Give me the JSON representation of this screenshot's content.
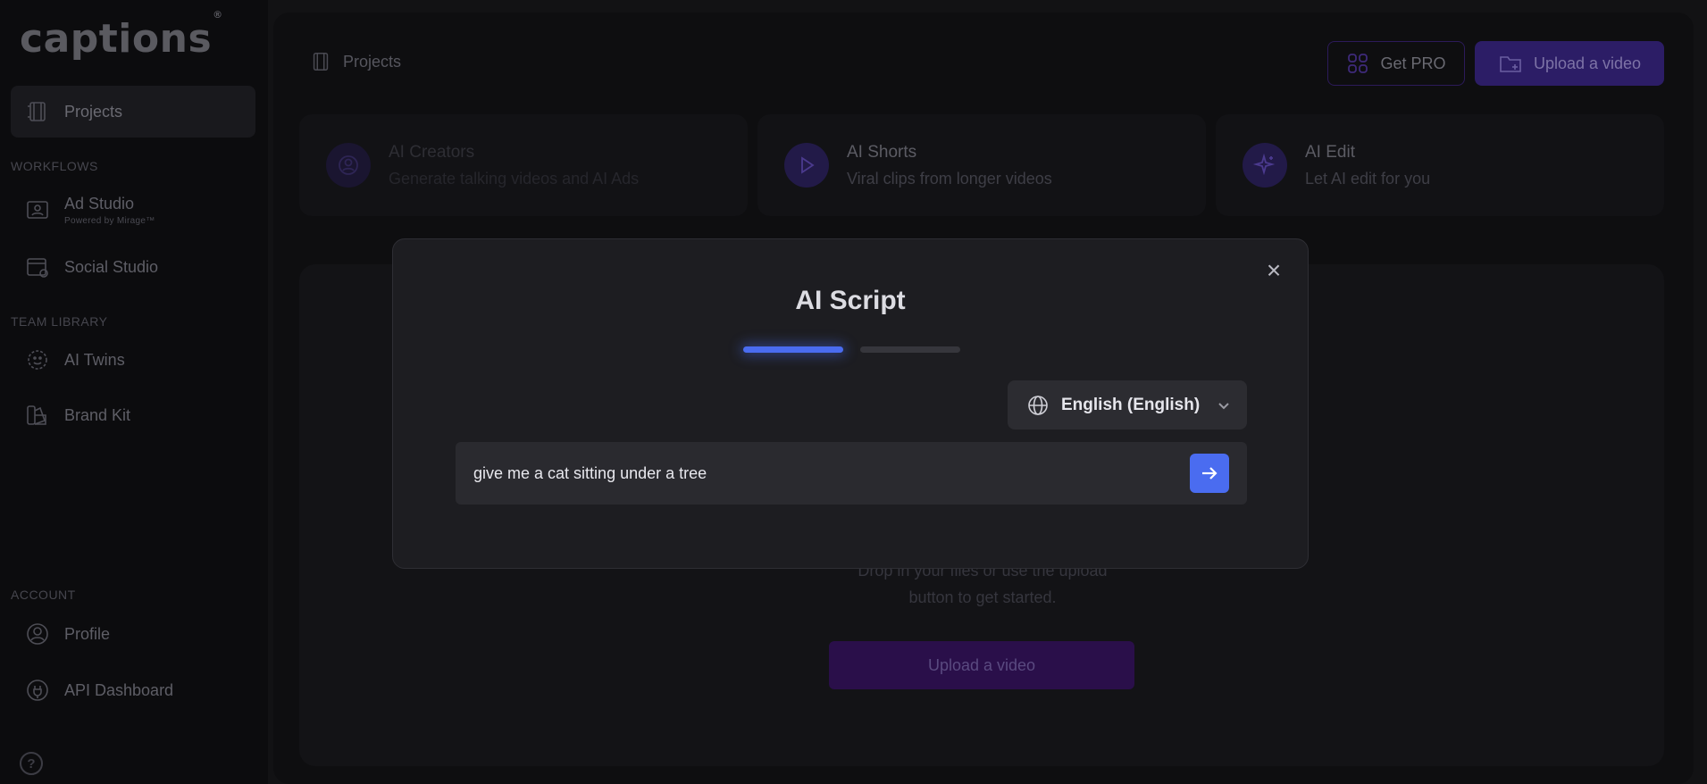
{
  "brand": {
    "name": "captions",
    "mark": "®"
  },
  "sidebar": {
    "projects": "Projects",
    "workflows_label": "WORKFLOWS",
    "ad_studio": {
      "label": "Ad Studio",
      "sub": "Powered by Mirage™"
    },
    "social_studio": "Social Studio",
    "team_library_label": "TEAM LIBRARY",
    "ai_twins": "AI Twins",
    "brand_kit": "Brand Kit",
    "account_label": "ACCOUNT",
    "profile": "Profile",
    "api_dashboard": "API Dashboard",
    "help": "?"
  },
  "header": {
    "breadcrumb": "Projects",
    "get_pro": "Get PRO",
    "upload": "Upload a video"
  },
  "features": [
    {
      "title": "AI Creators",
      "desc": "Generate talking videos and AI Ads",
      "icon": "user-circle-icon"
    },
    {
      "title": "AI Shorts",
      "desc": "Viral clips from longer videos",
      "icon": "play-icon"
    },
    {
      "title": "AI Edit",
      "desc": "Let AI edit for you",
      "icon": "sparkle-icon"
    }
  ],
  "dropzone": {
    "line1": "Drop in your files or use the upload",
    "line2": "button to get started.",
    "button": "Upload a video"
  },
  "modal": {
    "title": "AI Script",
    "close": "×",
    "steps_total": 2,
    "current_step": 1,
    "language": "English (English)",
    "prompt_value": "give me a cat sitting under a tree",
    "accent": "#4a6cf0"
  }
}
